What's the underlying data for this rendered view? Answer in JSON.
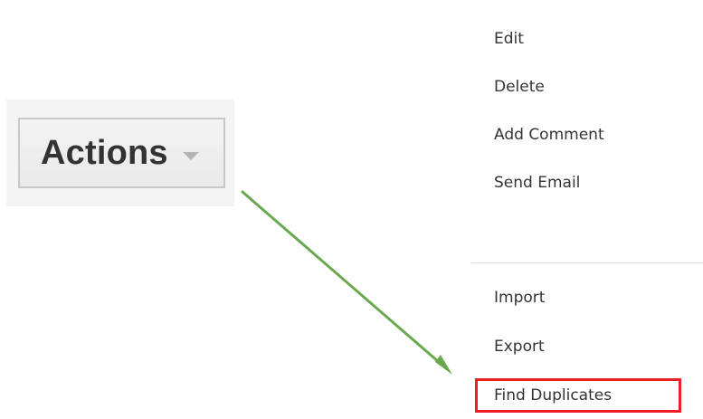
{
  "actions_button": {
    "label": "Actions",
    "icon": "chevron-down-icon"
  },
  "menu": {
    "group_one": [
      "Edit",
      "Delete",
      "Add Comment",
      "Send Email"
    ],
    "group_two": [
      "Import",
      "Export",
      "Find Duplicates"
    ]
  },
  "annotation": {
    "arrow_color": "#6aa84f",
    "highlight_color": "#ee1c25"
  }
}
